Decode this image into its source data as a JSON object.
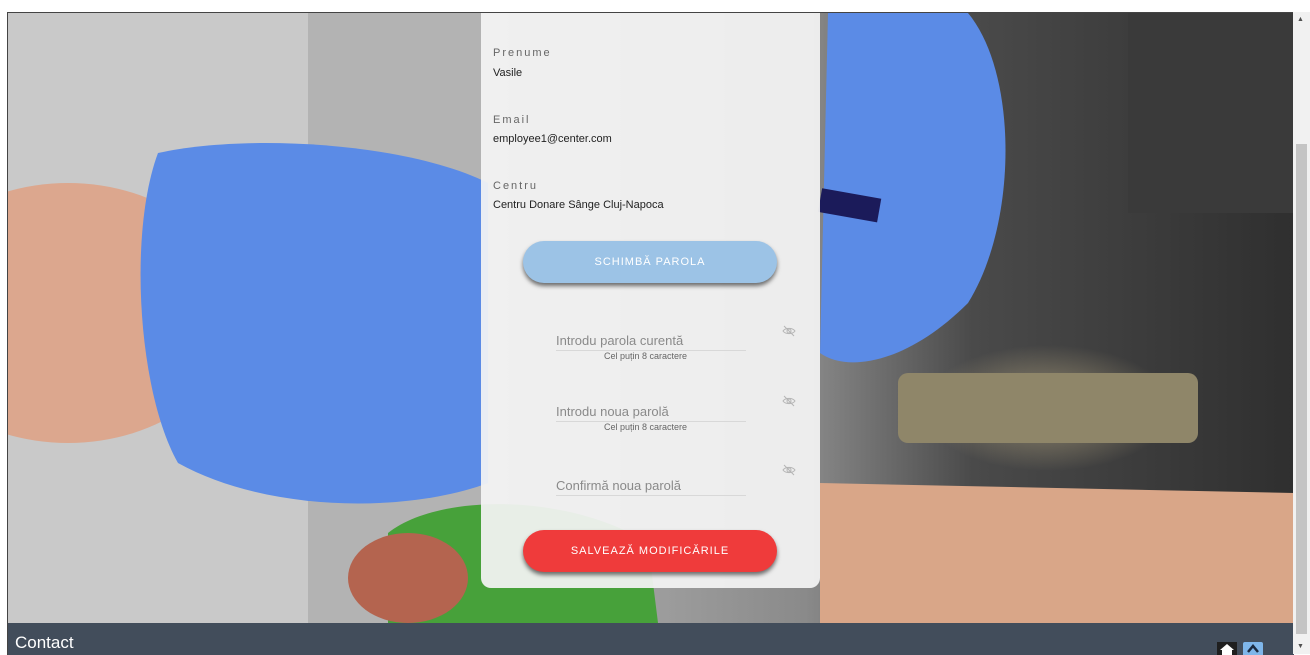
{
  "profile": {
    "first_name_label": "Prenume",
    "first_name_value": "Vasile",
    "email_label": "Email",
    "email_value": "employee1@center.com",
    "center_label": "Centru",
    "center_value": "Centru Donare Sânge Cluj-Napoca"
  },
  "buttons": {
    "change_password": "SCHIMBĂ PAROLA",
    "save_changes": "SALVEAZĂ MODIFICĂRILE"
  },
  "password_form": {
    "current_placeholder": "Introdu parola curentă",
    "current_hint": "Cel puțin 8 caractere",
    "new_placeholder": "Introdu noua parolă",
    "new_hint": "Cel puțin 8 caractere",
    "confirm_placeholder": "Confirmă noua parolă"
  },
  "footer": {
    "title": "Contact"
  },
  "icons": {
    "toggle_visibility": "eye-off-icon",
    "home": "home-icon",
    "scroll_top": "chevron-up-icon"
  },
  "colors": {
    "change_button": "#9cc3e6",
    "save_button": "#ef3b3b",
    "footer_bg": "#424d5b",
    "scroll_top_bg": "#7fb6ea"
  }
}
